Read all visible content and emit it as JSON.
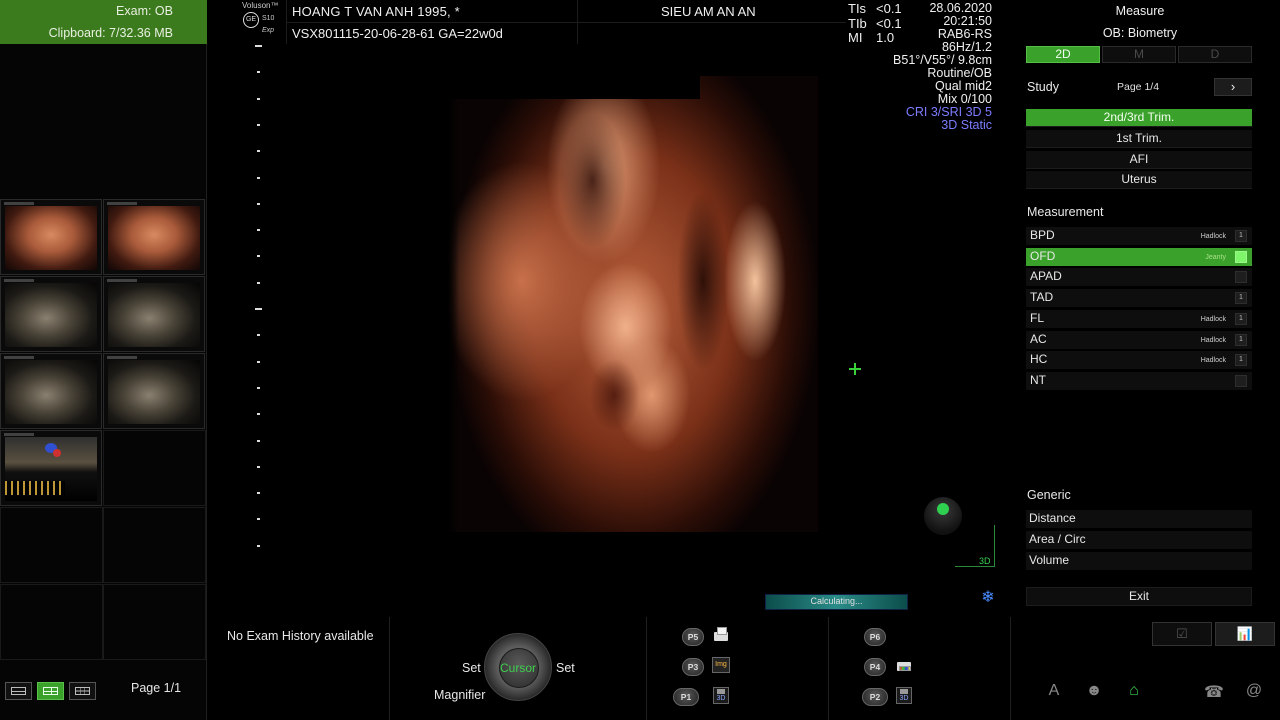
{
  "left_panel": {
    "exam_label": "Exam:  OB",
    "clipboard_label": "Clipboard:  7/32.36 MB",
    "page_label": "Page 1/1"
  },
  "header": {
    "brand": "Voluson™",
    "ge_mark": "GE",
    "model": "S10",
    "edition": "Exp",
    "patient_name": "HOANG T VAN ANH 1995,   *",
    "patient_id": "VSX801115-20-06-28-61   GA=22w0d",
    "institution": "SIEU AM AN AN",
    "indices": [
      {
        "key": "TIs",
        "value": "<0.1"
      },
      {
        "key": "TIb",
        "value": "<0.1"
      },
      {
        "key": "MI",
        "value": "1.0"
      }
    ],
    "date": "28.06.2020",
    "time": "20:21:50",
    "probe": "RAB6-RS",
    "freq": "86Hz/1.2",
    "angles": "B51°/V55°/ 9.8cm",
    "preset": "Routine/OB",
    "quality": "Qual mid2",
    "mix": "Mix 0/100",
    "cri": "CRI 3/SRI 3D 5",
    "static": "3D Static"
  },
  "image": {
    "mode_indicator": "3D",
    "status": "Calculating...",
    "icon_snow": "snowflake-icon"
  },
  "bottom": {
    "history": "No Exam History available",
    "knob_label": "Cursor",
    "set_left": "Set",
    "set_right": "Set",
    "magnifier": "Magnifier",
    "p_buttons": [
      "P5",
      "P3",
      "P1",
      "P6",
      "P4",
      "P2"
    ],
    "img_tag": "Img",
    "disk_tag": "3D"
  },
  "right_panel": {
    "title": "Measure",
    "subtitle": "OB: Biometry",
    "mode_tabs": [
      "2D",
      "M",
      "D"
    ],
    "study_label": "Study",
    "study_page": "Page 1/4",
    "study_next": "›",
    "study_options": [
      "2nd/3rd Trim.",
      "1st Trim.",
      "AFI",
      "Uterus"
    ],
    "measurement_label": "Measurement",
    "measurements": [
      {
        "name": "BPD",
        "author": "Hadlock",
        "count": "1"
      },
      {
        "name": "OFD",
        "author": "Jeanty",
        "count": ""
      },
      {
        "name": "APAD",
        "author": "",
        "count": ""
      },
      {
        "name": "TAD",
        "author": "",
        "count": "1"
      },
      {
        "name": "FL",
        "author": "Hadlock",
        "count": "1"
      },
      {
        "name": "AC",
        "author": "Hadlock",
        "count": "1"
      },
      {
        "name": "HC",
        "author": "Hadlock",
        "count": "1"
      },
      {
        "name": "NT",
        "author": "",
        "count": ""
      }
    ],
    "generic_label": "Generic",
    "generic_items": [
      "Distance",
      "Area / Circ",
      "Volume"
    ],
    "exit": "Exit",
    "mini_tabs": [
      "☑",
      "📊"
    ],
    "system_icons": [
      "A",
      "☻",
      "⌂",
      "☎",
      "@"
    ]
  },
  "colors": {
    "accent_green": "#3aa12a",
    "exam_green": "#3c7a1e",
    "blue_text": "#7c7cff"
  }
}
